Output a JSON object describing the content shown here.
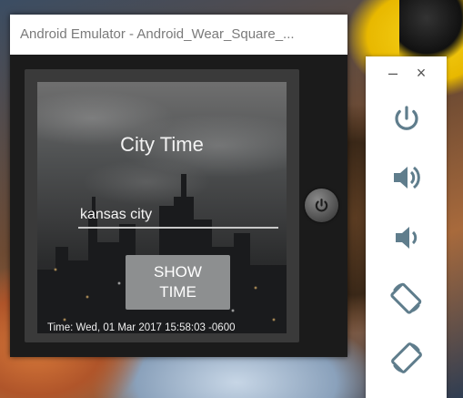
{
  "window": {
    "title": "Android Emulator - Android_Wear_Square_..."
  },
  "app": {
    "title": "City Time",
    "city_input_value": "kansas city",
    "show_button_label": "SHOW TIME",
    "time_text": "Time: Wed, 01 Mar 2017 15:58:03 -0600"
  },
  "toolbar": {
    "minimize_label": "–",
    "close_label": "×",
    "items": [
      {
        "icon": "power-icon"
      },
      {
        "icon": "volume-up-icon"
      },
      {
        "icon": "volume-down-icon"
      },
      {
        "icon": "rotate-left-icon"
      },
      {
        "icon": "rotate-right-icon"
      }
    ]
  },
  "colors": {
    "toolbar_icon": "#5f7d8c",
    "button_bg": "#8d8f90"
  }
}
